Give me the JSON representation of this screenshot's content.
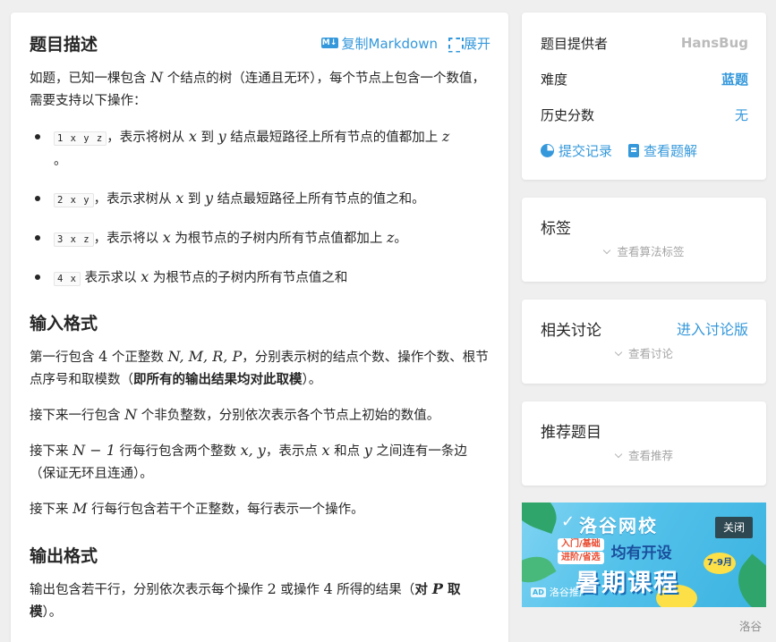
{
  "problem": {
    "title": "题目描述",
    "copy_markdown_label": "复制Markdown",
    "md_icon_text": "M↓",
    "expand_label": "展开",
    "intro_part1": "如题，已知一棵包含 ",
    "intro_N": "N",
    "intro_part2": " 个结点的树（连通且无环），每个节点上包含一个数值，需要支持以下操作：",
    "ops": [
      {
        "code": "1 x y z",
        "p1": "，表示将树从 ",
        "v1": "x",
        "p2": " 到 ",
        "v2": "y",
        "p3": " 结点最短路径上所有节点的值都加上 ",
        "v3": "z",
        "p4": "。"
      },
      {
        "code": "2 x y",
        "p1": "，表示求树从 ",
        "v1": "x",
        "p2": " 到 ",
        "v2": "y",
        "p3": " 结点最短路径上所有节点的值之和。",
        "v3": "",
        "p4": ""
      },
      {
        "code": "3 x z",
        "p1": "，表示将以 ",
        "v1": "x",
        "p2": " 为根节点的子树内所有节点值都加上 ",
        "v2": "z",
        "p3": "。",
        "v3": "",
        "p4": ""
      },
      {
        "code": "4 x",
        "p1": " 表示求以 ",
        "v1": "x",
        "p2": " 为根节点的子树内所有节点值之和",
        "v2": "",
        "p3": "",
        "v3": "",
        "p4": ""
      }
    ]
  },
  "input": {
    "title": "输入格式",
    "l1_p1": "第一行包含 ",
    "l1_n": "4",
    "l1_p2": " 个正整数 ",
    "l1_vars": "N, M, R, P",
    "l1_p3": "，分别表示树的结点个数、操作个数、根节点序号和取模数（",
    "l1_bold": "即所有的输出结果均对此取模",
    "l1_p4": "）。",
    "l2_p1": "接下来一行包含 ",
    "l2_v": "N",
    "l2_p2": " 个非负整数，分别依次表示各个节点上初始的数值。",
    "l3_p1": "接下来 ",
    "l3_v": "N − 1",
    "l3_p2": " 行每行包含两个整数 ",
    "l3_vars": "x, y",
    "l3_p3": "，表示点 ",
    "l3_v2": "x",
    "l3_p4": " 和点 ",
    "l3_v3": "y",
    "l3_p5": " 之间连有一条边（保证无环且连通）。",
    "l4_p1": "接下来 ",
    "l4_v": "M",
    "l4_p2": " 行每行包含若干个正整数，每行表示一个操作。"
  },
  "output": {
    "title": "输出格式",
    "p1": "输出包含若干行，分别依次表示每个操作 ",
    "n1": "2",
    "p2": " 或操作 ",
    "n2": "4",
    "p3": " 所得的结果（",
    "bold1": "对 ",
    "bold_v": "P",
    "bold2": " 取模",
    "p4": "）。"
  },
  "info": {
    "provider_label": "题目提供者",
    "provider_value": "HansBug",
    "difficulty_label": "难度",
    "difficulty_value": "蓝题",
    "history_label": "历史分数",
    "history_value": "无",
    "submit_label": "提交记录",
    "solution_label": "查看题解"
  },
  "tags": {
    "title": "标签",
    "more_label": "查看算法标签"
  },
  "discuss": {
    "title": "相关讨论",
    "enter_label": "进入讨论版",
    "more_label": "查看讨论"
  },
  "recommend": {
    "title": "推荐题目",
    "more_label": "查看推荐"
  },
  "banner": {
    "title": "洛谷网校",
    "tag1": "入门/基础",
    "tag2": "进阶/省选",
    "tag_text": "均有开设",
    "date": "7-9月",
    "big_text": "暑期课程",
    "close_label": "关闭",
    "ad_chip": "AD",
    "ad_text": "洛谷推广"
  },
  "footer": {
    "brand": "洛谷"
  },
  "colors": {
    "accent": "#3498db",
    "background": "#efefef",
    "provider_gray": "#bbbbbb"
  }
}
